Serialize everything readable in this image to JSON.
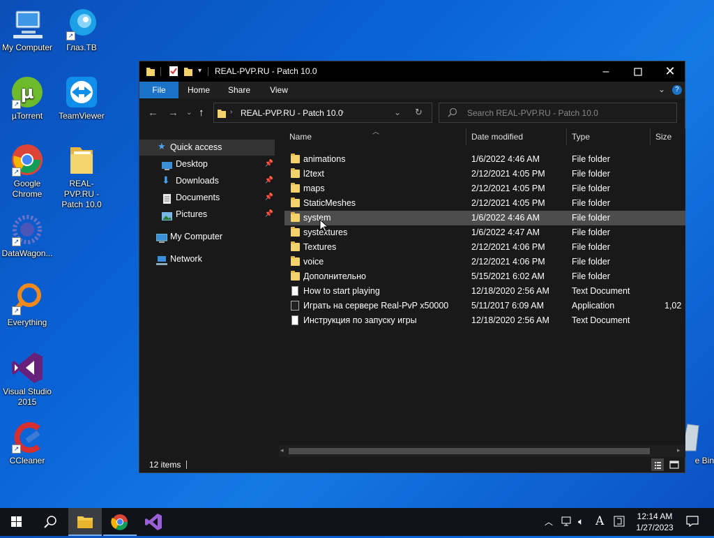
{
  "desktop": {
    "icons": [
      {
        "label": "My Computer"
      },
      {
        "label": "Глаз.TB"
      },
      {
        "label": "µTorrent"
      },
      {
        "label": "TeamViewer"
      },
      {
        "label": "Google Chrome"
      },
      {
        "label": "REAL-PVP.RU - Patch 10.0"
      },
      {
        "label": "DataWagon..."
      },
      {
        "label": "Everything"
      },
      {
        "label": "Visual Studio 2015"
      },
      {
        "label": "CCleaner"
      },
      {
        "label": "e Bin"
      }
    ]
  },
  "window": {
    "title": "REAL-PVP.RU - Patch 10.0",
    "ribbon_tabs": [
      "File",
      "Home",
      "Share",
      "View"
    ],
    "address_path": "REAL-PVP.RU - Patch 10.0",
    "search_placeholder": "Search REAL-PVP.RU - Patch 10.0",
    "nav": {
      "quick_access": "Quick access",
      "pinned": [
        "Desktop",
        "Downloads",
        "Documents",
        "Pictures"
      ],
      "my_computer": "My Computer",
      "network": "Network"
    },
    "columns": [
      "Name",
      "Date modified",
      "Type",
      "Size"
    ],
    "files": [
      {
        "name": "animations",
        "date": "1/6/2022 4:46 AM",
        "type": "File folder",
        "size": "",
        "kind": "folder"
      },
      {
        "name": "l2text",
        "date": "2/12/2021 4:05 PM",
        "type": "File folder",
        "size": "",
        "kind": "folder"
      },
      {
        "name": "maps",
        "date": "2/12/2021 4:05 PM",
        "type": "File folder",
        "size": "",
        "kind": "folder"
      },
      {
        "name": "StaticMeshes",
        "date": "2/12/2021 4:05 PM",
        "type": "File folder",
        "size": "",
        "kind": "folder"
      },
      {
        "name": "system",
        "date": "1/6/2022 4:46 AM",
        "type": "File folder",
        "size": "",
        "kind": "folder"
      },
      {
        "name": "systextures",
        "date": "1/6/2022 4:47 AM",
        "type": "File folder",
        "size": "",
        "kind": "folder"
      },
      {
        "name": "Textures",
        "date": "2/12/2021 4:06 PM",
        "type": "File folder",
        "size": "",
        "kind": "folder"
      },
      {
        "name": "voice",
        "date": "2/12/2021 4:06 PM",
        "type": "File folder",
        "size": "",
        "kind": "folder"
      },
      {
        "name": "Дополнительно",
        "date": "5/15/2021 6:02 AM",
        "type": "File folder",
        "size": "",
        "kind": "folder"
      },
      {
        "name": "How to start playing",
        "date": "12/18/2020 2:56 AM",
        "type": "Text Document",
        "size": "",
        "kind": "text"
      },
      {
        "name": "Играть на сервере Real-PvP x50000",
        "date": "5/11/2017 6:09 AM",
        "type": "Application",
        "size": "1,02",
        "kind": "app"
      },
      {
        "name": "Инструкция по запуску игры",
        "date": "12/18/2020 2:56 AM",
        "type": "Text Document",
        "size": "",
        "kind": "text"
      }
    ],
    "status": "12 items"
  },
  "taskbar": {
    "time": "12:14 AM",
    "date": "1/27/2023",
    "input_indicator": "A"
  }
}
